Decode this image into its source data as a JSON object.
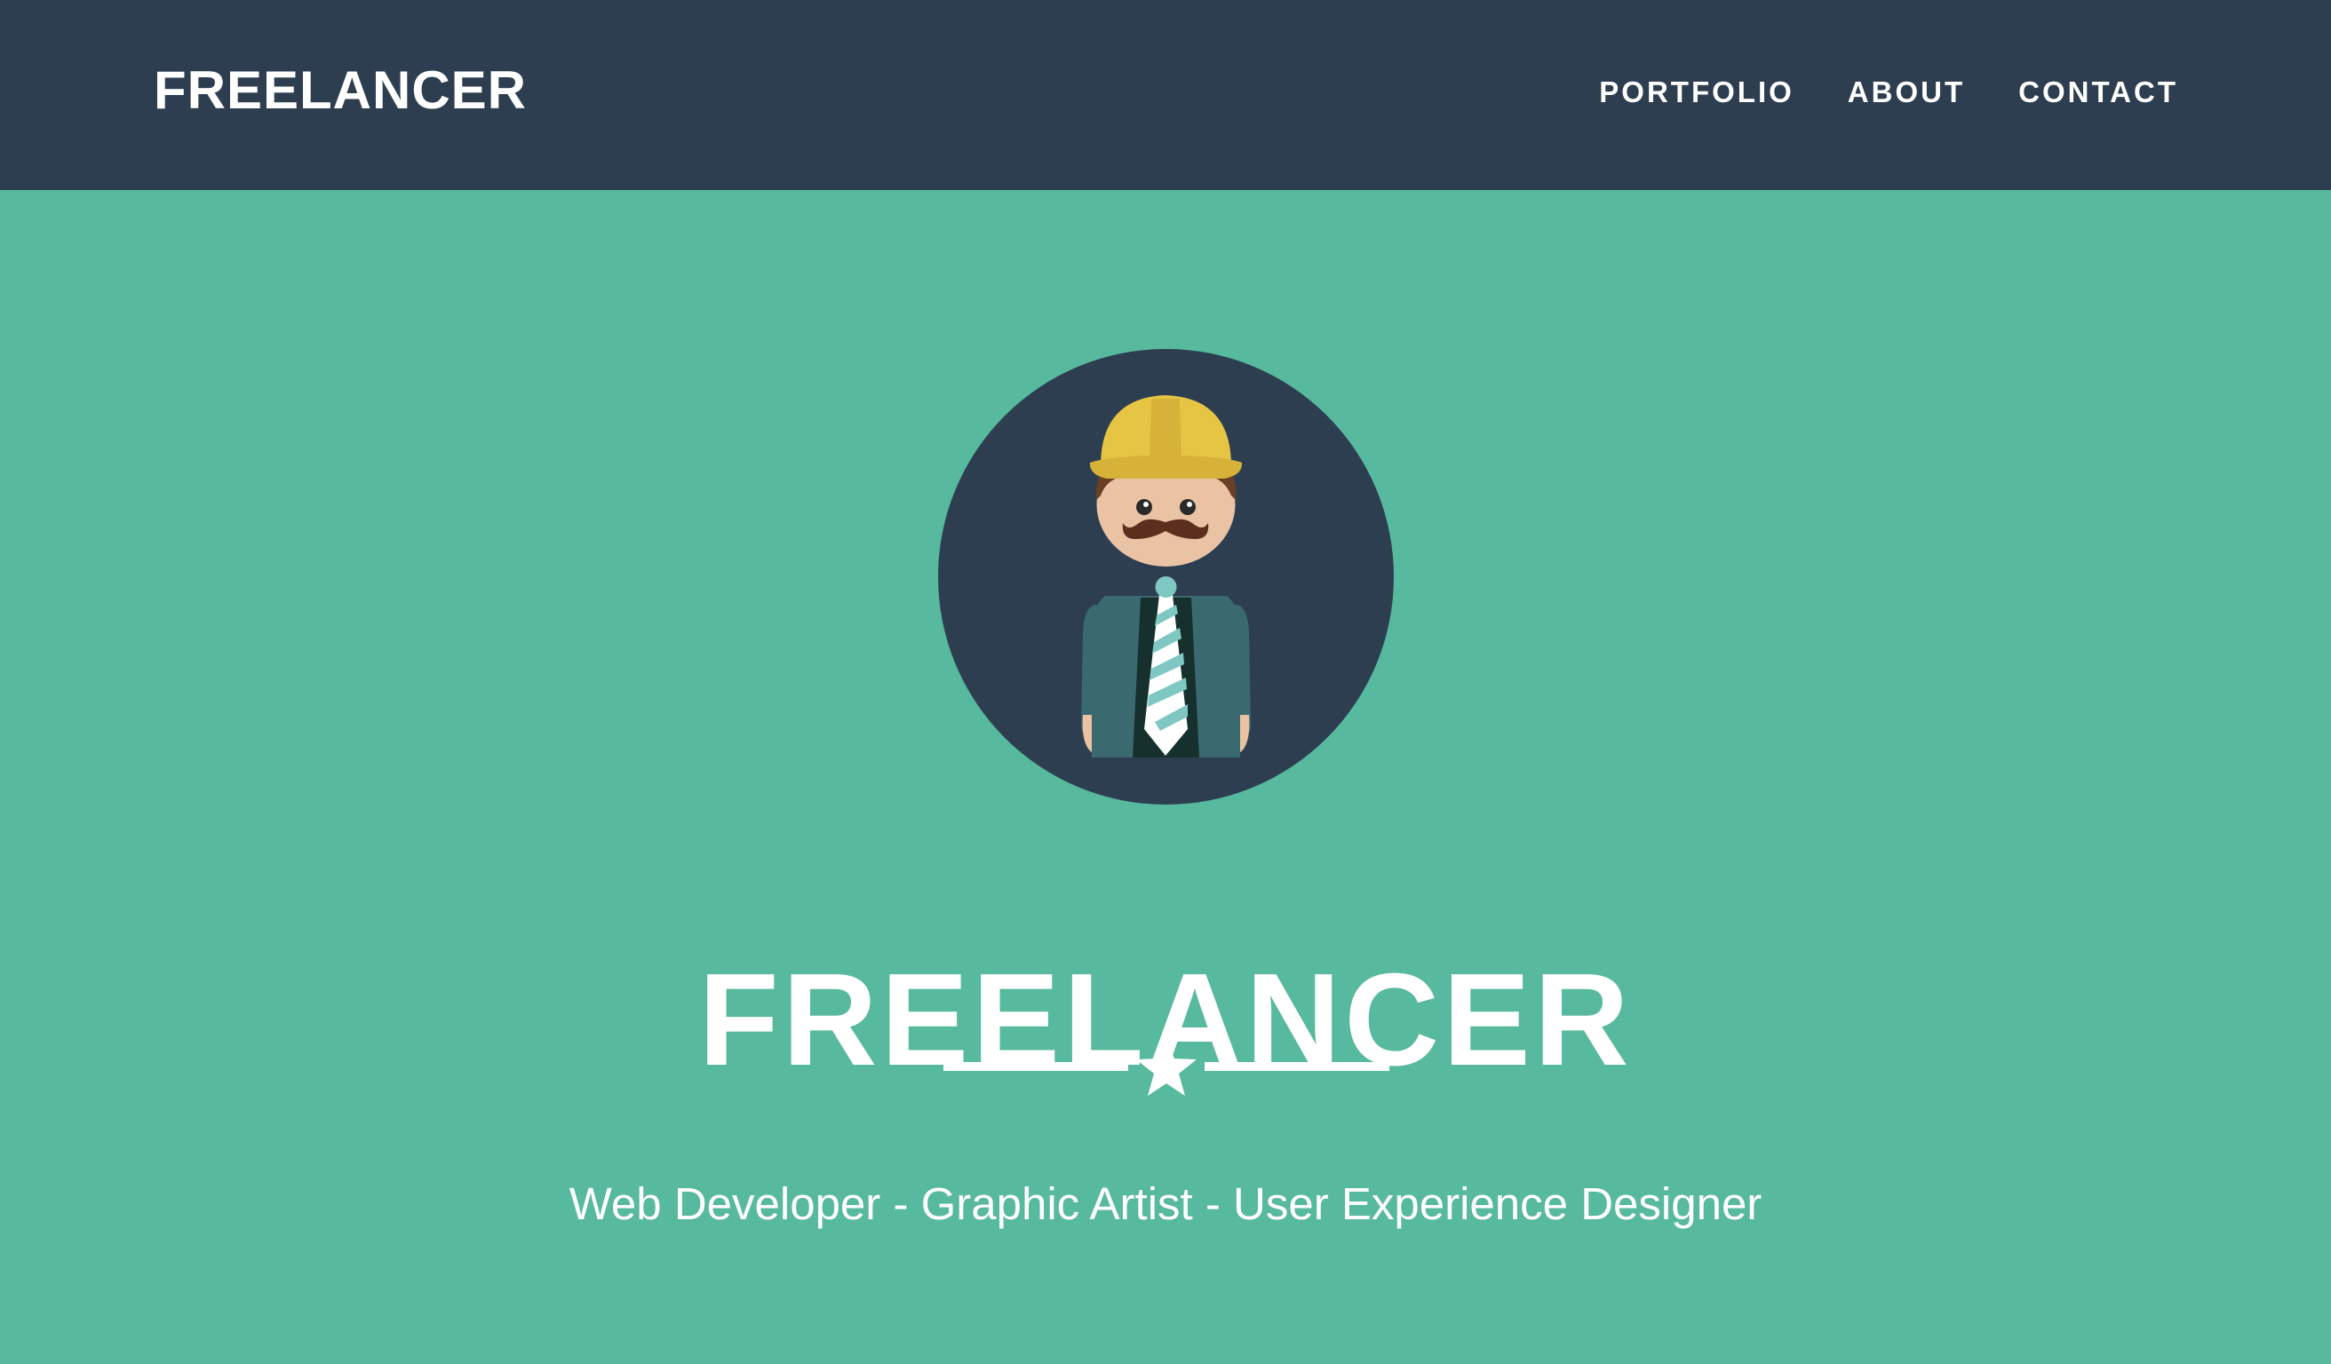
{
  "navbar": {
    "brand": "FREELANCER",
    "links": [
      {
        "label": "PORTFOLIO"
      },
      {
        "label": "ABOUT"
      },
      {
        "label": "CONTACT"
      }
    ]
  },
  "hero": {
    "title": "FREELANCER",
    "subtitle": "Web Developer - Graphic Artist - User Experience Designer",
    "avatar_icon": "construction-worker-avatar",
    "divider_icon": "star-icon"
  },
  "colors": {
    "navbar_bg": "#2e3e51",
    "hero_bg": "#57b99d",
    "text": "#ffffff",
    "helmet": "#e6c545",
    "jacket": "#3a6a70"
  }
}
